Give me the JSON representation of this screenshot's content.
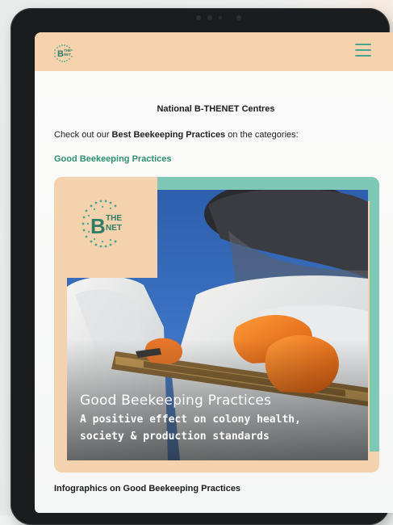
{
  "header": {
    "logo_text_top": "THE",
    "logo_text_bottom": "NET",
    "logo_letter": "B",
    "menu_icon": "hamburger-menu-icon"
  },
  "main": {
    "centres_title": "National B-THENET Centres",
    "intro_prefix": "Check out our ",
    "intro_bold": "Best Beekeeping Practices",
    "intro_suffix": " on the categories:",
    "category_link": "Good Beekeeping Practices"
  },
  "card": {
    "logo_letter": "B",
    "logo_text_top": "THE",
    "logo_text_bottom": "NET",
    "title": "Good Beekeeping Practices",
    "subtitle_line1": "A positive effect on colony health,",
    "subtitle_line2": "society & production standards"
  },
  "footer_section": {
    "heading": "Infographics on Good Beekeeping Practices"
  },
  "colors": {
    "header_bg": "#f7d3ad",
    "accent_green": "#2f8f72",
    "card_peach": "#f4d2ad",
    "card_teal": "#7fc8b6",
    "glove_orange": "#f07a1c"
  }
}
